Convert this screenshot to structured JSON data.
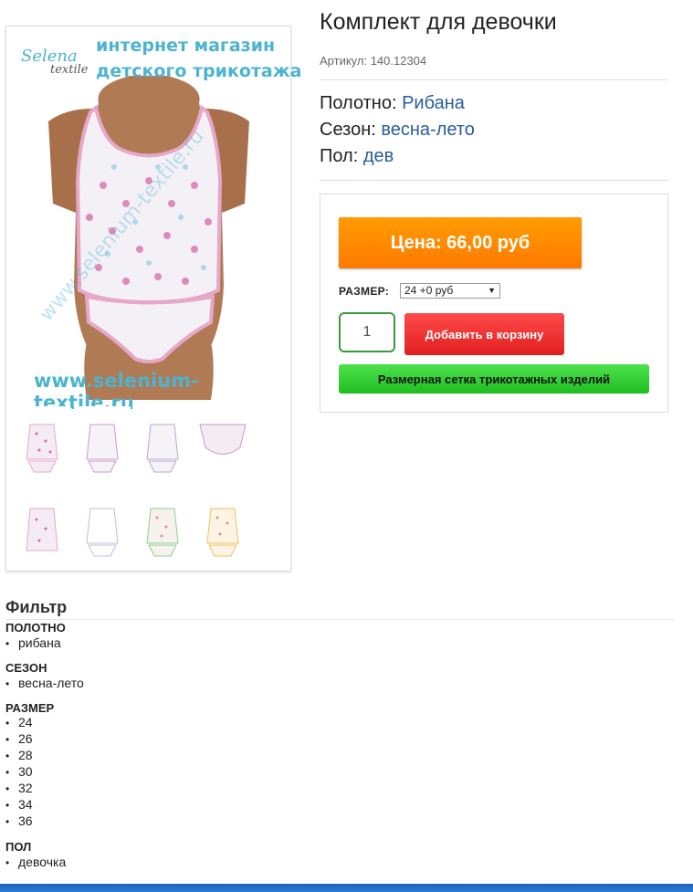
{
  "product": {
    "title": "Комплект для девочки",
    "sku": "Артикул: 140.12304",
    "properties": [
      {
        "label": "Полотно:",
        "value": "Рибана"
      },
      {
        "label": "Сезон:",
        "value": "весна-лето"
      },
      {
        "label": "Пол:",
        "value": "дев"
      }
    ]
  },
  "image": {
    "brand_line_1": "интернет магазин",
    "brand_line_2": "детского трикотажа",
    "logo_a": "Selena",
    "logo_b": "textile",
    "site_url": "www.selenium-textile.ru"
  },
  "buy": {
    "price_label": "Цена: 66,00 руб",
    "size_label": "РАЗМЕР:",
    "size_selected": "24 +0 руб",
    "quantity": "1",
    "add_to_cart": "Добавить в корзину",
    "size_chart": "Размерная сетка трикотажных изделий"
  },
  "filter": {
    "title": "Фильтр",
    "groups": [
      {
        "name": "ПОЛОТНО",
        "items": [
          "рибана"
        ]
      },
      {
        "name": "СЕЗОН",
        "items": [
          "весна-лето"
        ]
      },
      {
        "name": "РАЗМЕР",
        "items": [
          "24",
          "26",
          "28",
          "30",
          "32",
          "34",
          "36"
        ]
      },
      {
        "name": "ПОЛ",
        "items": [
          "девочка"
        ]
      }
    ]
  },
  "colors": {
    "price": "#ff8a00",
    "cart": "#ef2f2f",
    "size_chart": "#33cc33",
    "link": "#2a5b9c",
    "brand": "#4cb4cf"
  }
}
